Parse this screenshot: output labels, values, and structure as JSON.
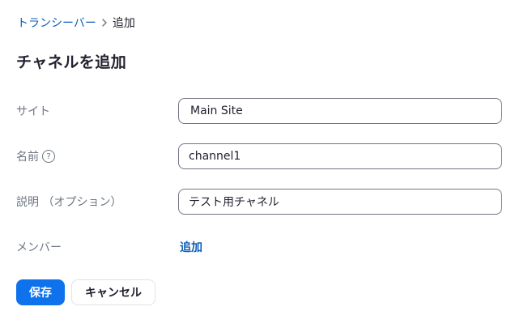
{
  "breadcrumb": {
    "parent": "トランシーバー",
    "current": "追加"
  },
  "page_title": "チャネルを追加",
  "form": {
    "site": {
      "label": "サイト",
      "value": "Main Site"
    },
    "name": {
      "label": "名前",
      "help_icon": "?",
      "value": "channel1"
    },
    "description": {
      "label": "説明 （オプション）",
      "value": "テスト用チャネル"
    },
    "members": {
      "label": "メンバー",
      "add_link": "追加"
    }
  },
  "buttons": {
    "save": "保存",
    "cancel": "キャンセル"
  },
  "colors": {
    "link": "#0e5eb4",
    "primary": "#0e72ed",
    "label": "#6e7680",
    "text": "#222230",
    "input_border": "#747487"
  }
}
